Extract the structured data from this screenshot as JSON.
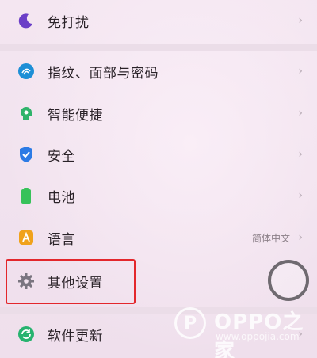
{
  "settings": {
    "items": [
      {
        "label": "免打扰",
        "icon": "moon-icon",
        "color": "#6b3fc7",
        "chevron": "›"
      },
      {
        "label": "指纹、面部与密码",
        "icon": "fingerprint-icon",
        "color": "#1e8fd6",
        "chevron": "›"
      },
      {
        "label": "智能便捷",
        "icon": "smart-assist-icon",
        "color": "#2fb36a",
        "chevron": "›"
      },
      {
        "label": "安全",
        "icon": "shield-icon",
        "color": "#2c7be5",
        "chevron": "›"
      },
      {
        "label": "电池",
        "icon": "battery-icon",
        "color": "#37c25a",
        "chevron": "›"
      },
      {
        "label": "语言",
        "icon": "language-icon",
        "color": "#f0a21b",
        "value": "简体中文",
        "chevron": "›"
      },
      {
        "label": "其他设置",
        "icon": "gear-icon",
        "color": "#7a7580"
      },
      {
        "label": "软件更新",
        "icon": "update-icon",
        "color": "#27b36f",
        "chevron": "›"
      }
    ]
  },
  "watermark": {
    "brand": "OPPO之家",
    "url": "www.oppojia.com",
    "logo_glyph": "P"
  }
}
